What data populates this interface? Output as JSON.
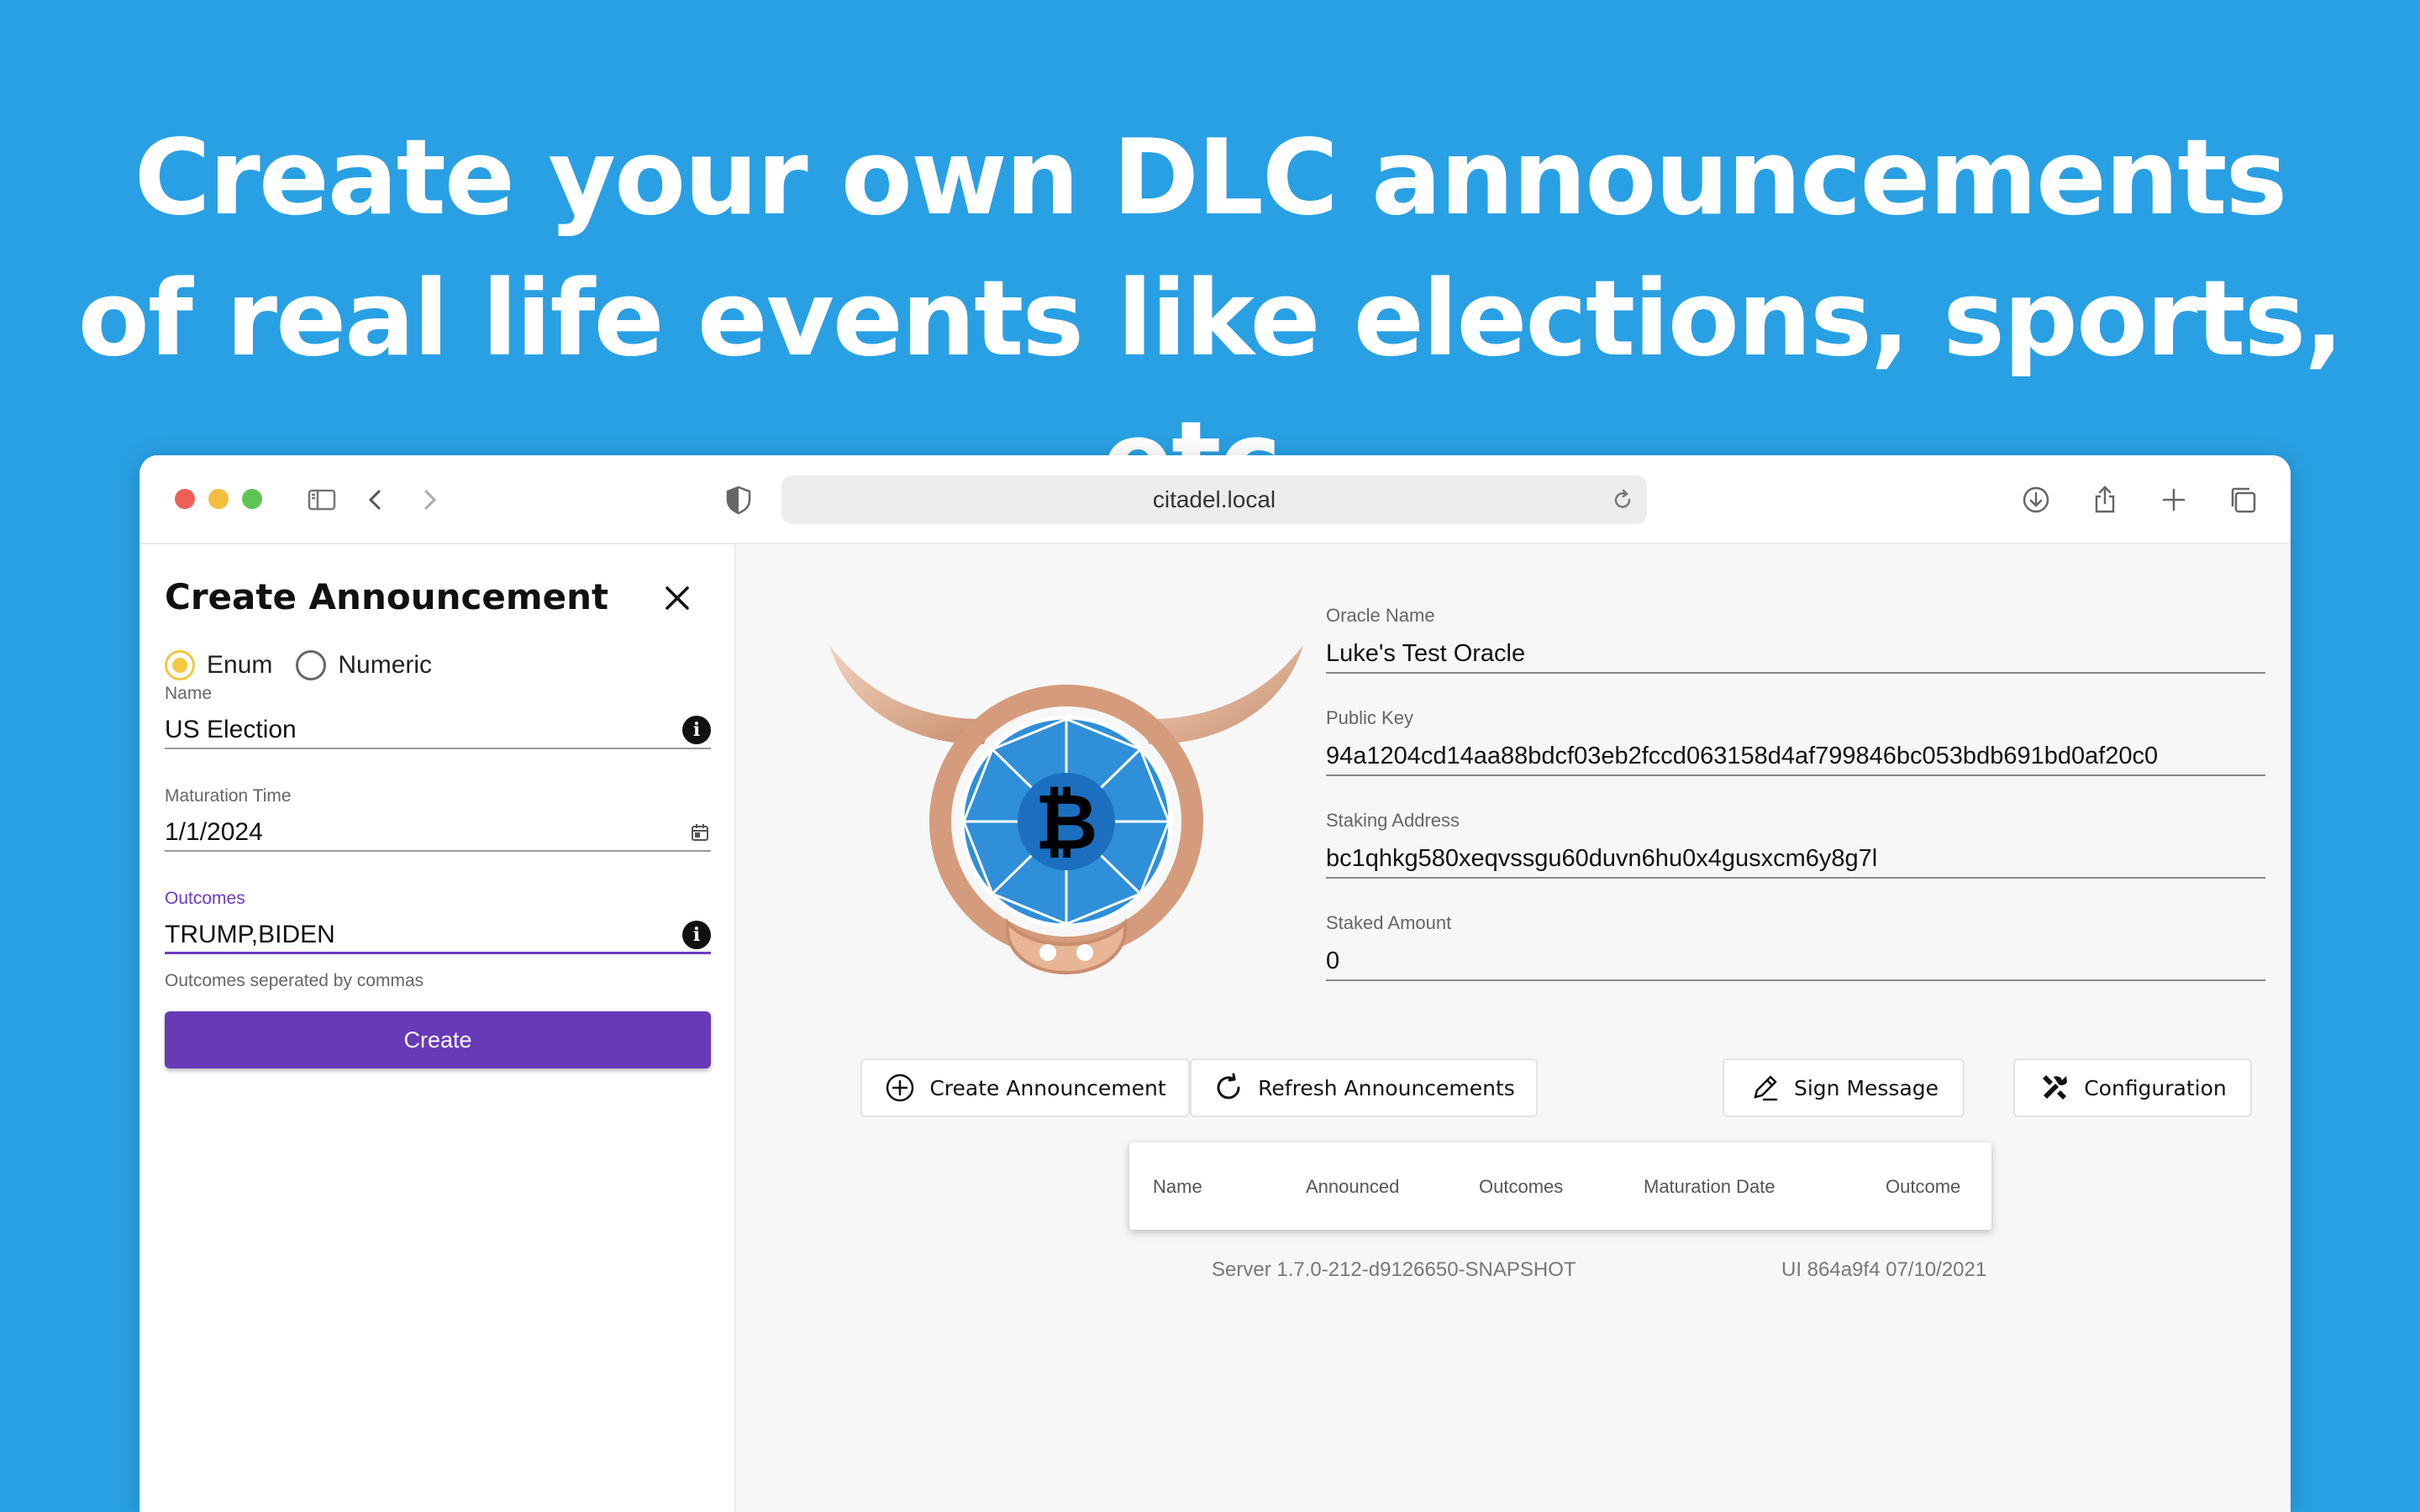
{
  "headline": {
    "line1": "Create your own DLC announcements",
    "line2": "of real life events like elections, sports, etc."
  },
  "browser": {
    "url": "citadel.local",
    "traffic_lights": [
      "#ed5f57",
      "#f5bd3e",
      "#5fc454"
    ]
  },
  "create_panel": {
    "title": "Create Announcement",
    "radio_enum": "Enum",
    "radio_numeric": "Numeric",
    "selected_type": "Enum",
    "name_label": "Name",
    "name_value": "US Election",
    "maturation_label": "Maturation Time",
    "maturation_value": "1/1/2024",
    "outcomes_label": "Outcomes",
    "outcomes_value": "TRUMP,BIDEN",
    "outcomes_helper": "Outcomes seperated by commas",
    "create_button": "Create",
    "accent_color": "#673ab7"
  },
  "oracle": {
    "name_label": "Oracle Name",
    "name_value": "Luke's Test Oracle",
    "pubkey_label": "Public Key",
    "pubkey_value": "94a1204cd14aa88bdcf03eb2fccd063158d4af799846bc053bdb691bd0af20c0",
    "staking_label": "Staking Address",
    "staking_value": "bc1qhkg580xeqvssgu60duvn6hu0x4gusxcm6y8g7l",
    "staked_label": "Staked Amount",
    "staked_value": "0"
  },
  "actions": {
    "create": "Create Announcement",
    "refresh": "Refresh Announcements",
    "sign": "Sign Message",
    "config": "Configuration"
  },
  "table": {
    "headers": [
      "Name",
      "Announced",
      "Outcomes",
      "Maturation Date",
      "Outcome"
    ]
  },
  "footer": {
    "server": "Server 1.7.0-212-d9126650-SNAPSHOT",
    "ui": "UI 864a9f4 07/10/2021"
  }
}
